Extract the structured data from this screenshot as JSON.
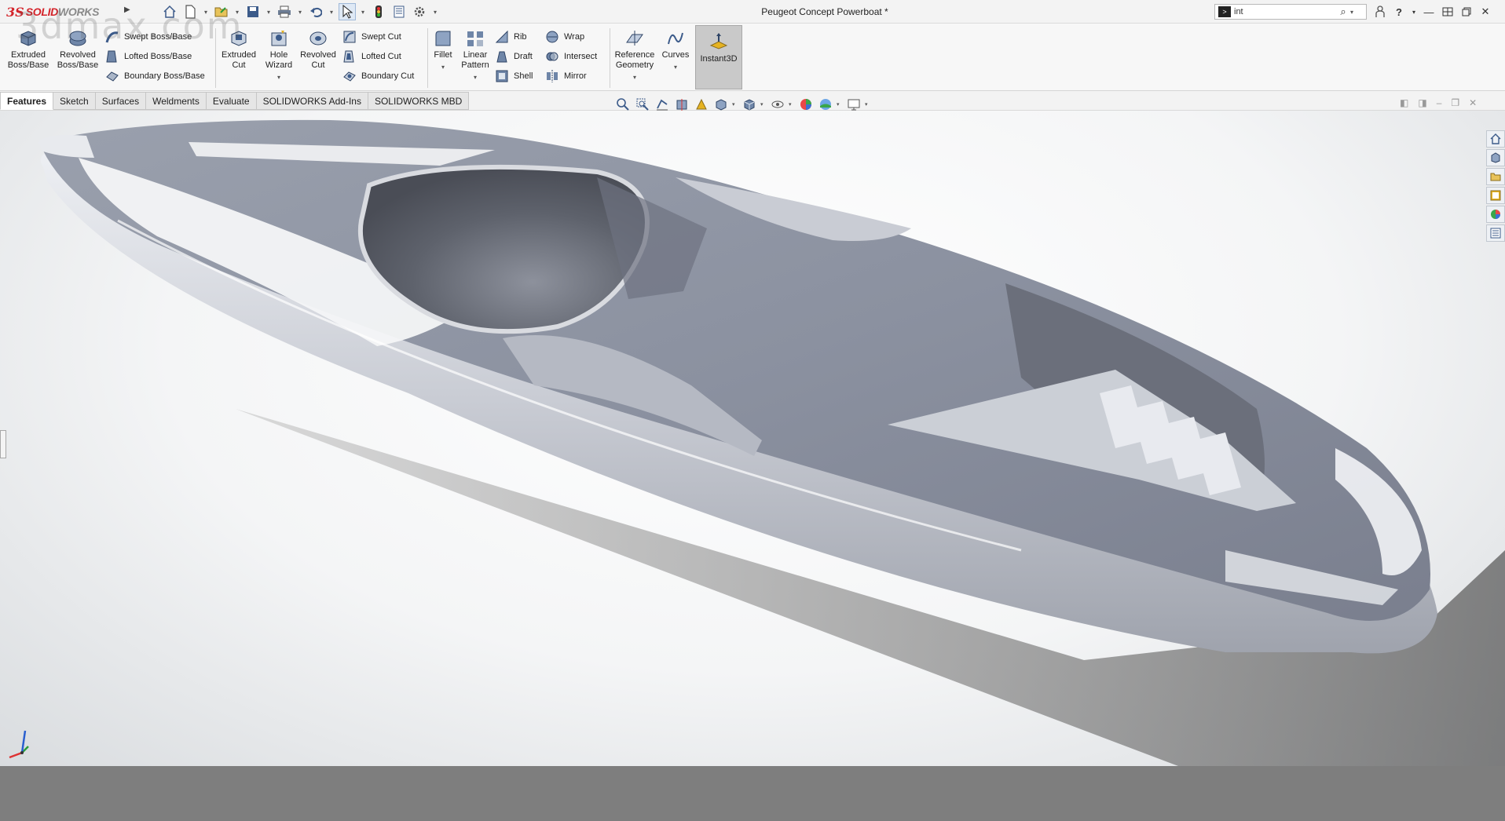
{
  "app": {
    "logo_ds": "3S",
    "logo_name_a": "SOLID",
    "logo_name_b": "WORKS",
    "document_title": "Peugeot Concept Powerboat *"
  },
  "search": {
    "value": "int"
  },
  "ribbon": {
    "extruded_boss": "Extruded Boss/Base",
    "revolved_boss": "Revolved Boss/Base",
    "swept_boss": "Swept Boss/Base",
    "lofted_boss": "Lofted Boss/Base",
    "boundary_boss": "Boundary Boss/Base",
    "extruded_cut": "Extruded Cut",
    "hole_wizard": "Hole Wizard",
    "revolved_cut": "Revolved Cut",
    "swept_cut": "Swept Cut",
    "lofted_cut": "Lofted Cut",
    "boundary_cut": "Boundary Cut",
    "fillet": "Fillet",
    "linear_pattern": "Linear Pattern",
    "rib": "Rib",
    "draft": "Draft",
    "shell": "Shell",
    "wrap": "Wrap",
    "intersect": "Intersect",
    "mirror": "Mirror",
    "reference_geometry": "Reference Geometry",
    "curves": "Curves",
    "instant3d": "Instant3D"
  },
  "tabs": [
    {
      "label": "Features",
      "active": true
    },
    {
      "label": "Sketch",
      "active": false
    },
    {
      "label": "Surfaces",
      "active": false
    },
    {
      "label": "Weldments",
      "active": false
    },
    {
      "label": "Evaluate",
      "active": false
    },
    {
      "label": "SOLIDWORKS Add-Ins",
      "active": false
    },
    {
      "label": "SOLIDWORKS MBD",
      "active": false
    }
  ],
  "watermark": "3dmax.com",
  "colors": {
    "brand_red": "#d4232a",
    "icon_blue": "#3c5b8a",
    "model_surface": "#8e93a1",
    "status_bar": "#7e7e7e"
  },
  "icons": {
    "search": "magnifier-icon",
    "help": "question-icon",
    "user": "user-icon"
  }
}
